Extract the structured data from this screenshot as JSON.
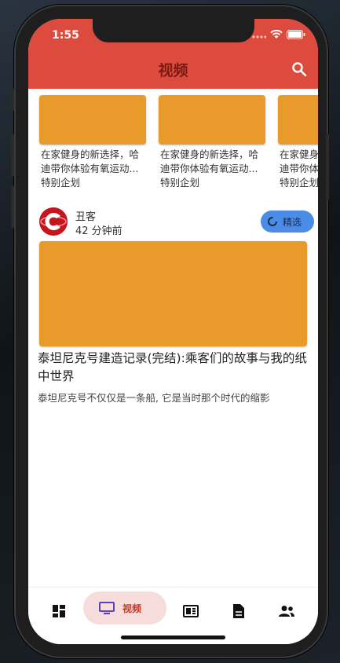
{
  "status": {
    "time": "1:55"
  },
  "appbar": {
    "title": "视频"
  },
  "featured": [
    {
      "desc": "在家健身的新选择，哈迪带你体验有氧运动...",
      "tag": "特别企划"
    },
    {
      "desc": "在家健身的新选择，哈迪带你体验有氧运动...",
      "tag": "特别企划"
    },
    {
      "desc": "在家健身的新选择，哈迪带你体验有氧运动...",
      "tag": "特别企划"
    }
  ],
  "post": {
    "author": "丑客",
    "time": "42 分钟前",
    "badge": "精选",
    "title": "泰坦尼克号建造记录(完结):乘客们的故事与我的纸中世界",
    "subtitle": "泰坦尼克号不仅仅是一条船, 它是当时那个时代的缩影"
  },
  "nav": {
    "active_label": "视频",
    "items": [
      "dashboard-icon",
      "tv-icon",
      "news-icon",
      "document-icon",
      "people-icon"
    ]
  },
  "colors": {
    "appbar": "#dd4b3e",
    "thumb": "#e89a2b",
    "badge": "#4a8ce8",
    "nav_active_bg": "#f6dcda"
  }
}
